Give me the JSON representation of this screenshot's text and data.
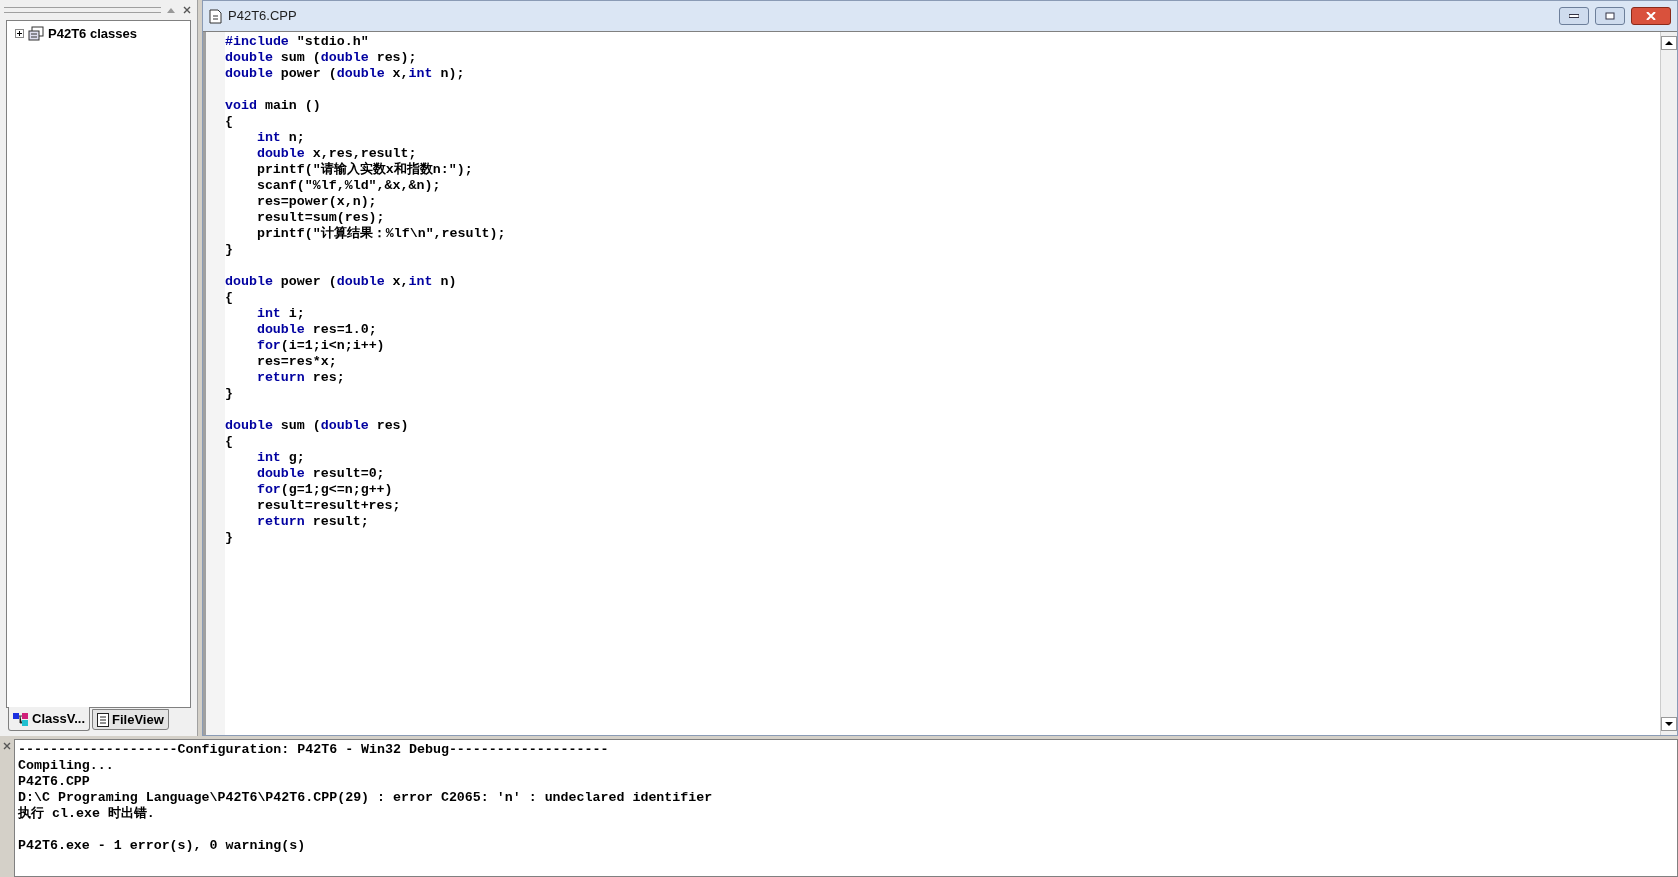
{
  "workspace": {
    "tree": [
      {
        "label": "P42T6 classes",
        "expanded": false
      }
    ],
    "tabs": [
      {
        "label": "ClassV...",
        "selected": true
      },
      {
        "label": "FileView",
        "selected": false
      }
    ]
  },
  "editor": {
    "title": "P42T6.CPP",
    "lines": [
      {
        "kind": "code",
        "segments": [
          {
            "kind": "keyword",
            "text": "#include"
          },
          {
            "kind": "plain",
            "text": " \"stdio.h\""
          }
        ]
      },
      {
        "kind": "code",
        "segments": [
          {
            "kind": "keyword",
            "text": "double"
          },
          {
            "kind": "plain",
            "text": " sum ("
          },
          {
            "kind": "keyword",
            "text": "double"
          },
          {
            "kind": "plain",
            "text": " res);"
          }
        ]
      },
      {
        "kind": "code",
        "segments": [
          {
            "kind": "keyword",
            "text": "double"
          },
          {
            "kind": "plain",
            "text": " power ("
          },
          {
            "kind": "keyword",
            "text": "double"
          },
          {
            "kind": "plain",
            "text": " x,"
          },
          {
            "kind": "keyword",
            "text": "int"
          },
          {
            "kind": "plain",
            "text": " n);"
          }
        ]
      },
      {
        "kind": "blank"
      },
      {
        "kind": "code",
        "segments": [
          {
            "kind": "keyword",
            "text": "void"
          },
          {
            "kind": "plain",
            "text": " main ()"
          }
        ]
      },
      {
        "kind": "code",
        "segments": [
          {
            "kind": "plain",
            "text": "{"
          }
        ]
      },
      {
        "kind": "code",
        "indented": true,
        "segments": [
          {
            "kind": "keyword",
            "text": "int"
          },
          {
            "kind": "plain",
            "text": " n;"
          }
        ]
      },
      {
        "kind": "code",
        "indented": true,
        "segments": [
          {
            "kind": "keyword",
            "text": "double"
          },
          {
            "kind": "plain",
            "text": " x,res,result;"
          }
        ]
      },
      {
        "kind": "code",
        "indented": true,
        "segments": [
          {
            "kind": "plain",
            "text": "printf(\"请输入实数x和指数n:\");"
          }
        ]
      },
      {
        "kind": "code",
        "indented": true,
        "segments": [
          {
            "kind": "plain",
            "text": "scanf(\"%lf,%ld\",&x,&n);"
          }
        ]
      },
      {
        "kind": "code",
        "indented": true,
        "segments": [
          {
            "kind": "plain",
            "text": "res=power(x,n);"
          }
        ]
      },
      {
        "kind": "code",
        "indented": true,
        "segments": [
          {
            "kind": "plain",
            "text": "result=sum(res);"
          }
        ]
      },
      {
        "kind": "code",
        "indented": true,
        "segments": [
          {
            "kind": "plain",
            "text": "printf(\"计算结果：%lf\\n\",result);"
          }
        ]
      },
      {
        "kind": "code",
        "segments": [
          {
            "kind": "plain",
            "text": "}"
          }
        ]
      },
      {
        "kind": "blank"
      },
      {
        "kind": "code",
        "segments": [
          {
            "kind": "keyword",
            "text": "double"
          },
          {
            "kind": "plain",
            "text": " power ("
          },
          {
            "kind": "keyword",
            "text": "double"
          },
          {
            "kind": "plain",
            "text": " x,"
          },
          {
            "kind": "keyword",
            "text": "int"
          },
          {
            "kind": "plain",
            "text": " n)"
          }
        ]
      },
      {
        "kind": "code",
        "segments": [
          {
            "kind": "plain",
            "text": "{"
          }
        ]
      },
      {
        "kind": "code",
        "indented": true,
        "segments": [
          {
            "kind": "keyword",
            "text": "int"
          },
          {
            "kind": "plain",
            "text": " i;"
          }
        ]
      },
      {
        "kind": "code",
        "indented": true,
        "segments": [
          {
            "kind": "keyword",
            "text": "double"
          },
          {
            "kind": "plain",
            "text": " res=1.0;"
          }
        ]
      },
      {
        "kind": "code",
        "indented": true,
        "segments": [
          {
            "kind": "keyword",
            "text": "for"
          },
          {
            "kind": "plain",
            "text": "(i=1;i<n;i++)"
          }
        ]
      },
      {
        "kind": "code",
        "indented": true,
        "segments": [
          {
            "kind": "plain",
            "text": "res=res*x;"
          }
        ]
      },
      {
        "kind": "code",
        "indented": true,
        "segments": [
          {
            "kind": "keyword",
            "text": "return"
          },
          {
            "kind": "plain",
            "text": " res;"
          }
        ]
      },
      {
        "kind": "code",
        "segments": [
          {
            "kind": "plain",
            "text": "}"
          }
        ]
      },
      {
        "kind": "blank"
      },
      {
        "kind": "code",
        "segments": [
          {
            "kind": "keyword",
            "text": "double"
          },
          {
            "kind": "plain",
            "text": " sum ("
          },
          {
            "kind": "keyword",
            "text": "double"
          },
          {
            "kind": "plain",
            "text": " res)"
          }
        ]
      },
      {
        "kind": "code",
        "segments": [
          {
            "kind": "plain",
            "text": "{"
          }
        ]
      },
      {
        "kind": "code",
        "indented": true,
        "segments": [
          {
            "kind": "keyword",
            "text": "int"
          },
          {
            "kind": "plain",
            "text": " g;"
          }
        ]
      },
      {
        "kind": "code",
        "indented": true,
        "segments": [
          {
            "kind": "keyword",
            "text": "double"
          },
          {
            "kind": "plain",
            "text": " result=0;"
          }
        ]
      },
      {
        "kind": "code",
        "indented": true,
        "segments": [
          {
            "kind": "keyword",
            "text": "for"
          },
          {
            "kind": "plain",
            "text": "(g=1;g<=n;g++)"
          }
        ]
      },
      {
        "kind": "code",
        "indented": true,
        "segments": [
          {
            "kind": "plain",
            "text": "result=result+res;"
          }
        ]
      },
      {
        "kind": "code",
        "indented": true,
        "segments": [
          {
            "kind": "keyword",
            "text": "return"
          },
          {
            "kind": "plain",
            "text": " result;"
          }
        ]
      },
      {
        "kind": "code",
        "segments": [
          {
            "kind": "plain",
            "text": "}"
          }
        ]
      }
    ]
  },
  "output": {
    "lines": [
      {
        "kind": "text",
        "text": "--------------------Configuration: P42T6 - Win32 Debug--------------------"
      },
      {
        "kind": "text",
        "text": "Compiling..."
      },
      {
        "kind": "text",
        "text": "P42T6.CPP"
      },
      {
        "kind": "text",
        "text": "D:\\C Programing Language\\P42T6\\P42T6.CPP(29) : error C2065: 'n' : undeclared identifier"
      },
      {
        "kind": "text",
        "text": "执行 cl.exe 时出错."
      },
      {
        "kind": "blank"
      },
      {
        "kind": "text",
        "text": "P42T6.exe - 1 error(s), 0 warning(s)"
      }
    ]
  }
}
